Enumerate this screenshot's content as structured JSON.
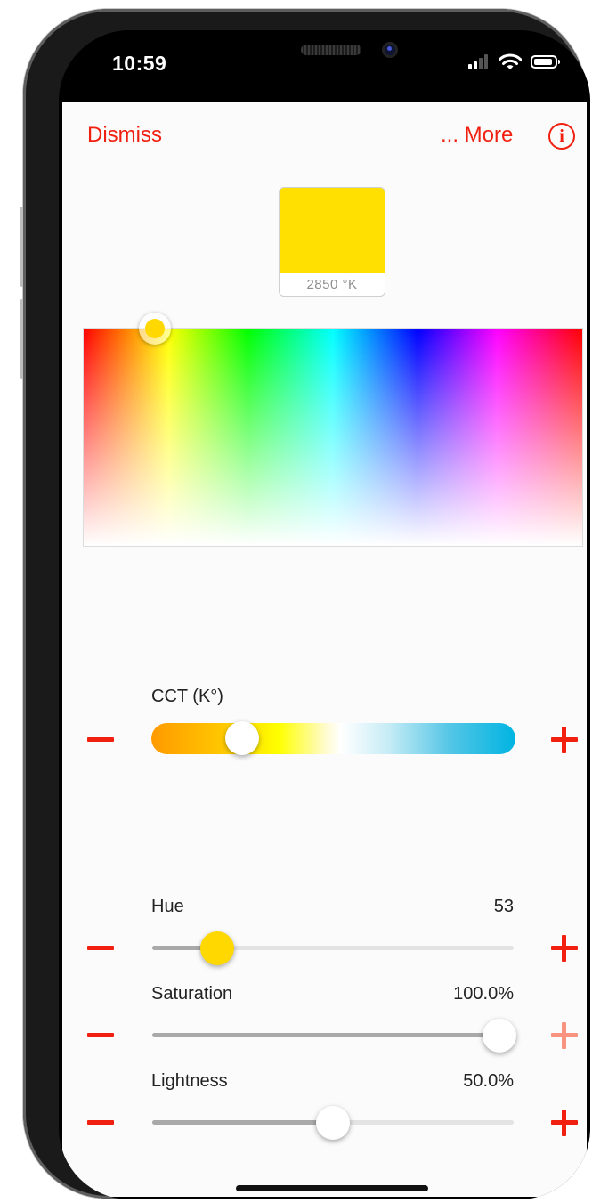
{
  "status_bar": {
    "time": "10:59"
  },
  "nav": {
    "dismiss_label": "Dismiss",
    "more_label": "... More",
    "info_icon": "info-icon"
  },
  "swatch": {
    "color": "#ffe000",
    "label": "2850 °K"
  },
  "spectrum_picker": {
    "selected_color": "#ffd800"
  },
  "cct": {
    "label": "CCT (K°)",
    "position_fraction": 0.25
  },
  "sliders": [
    {
      "label": "Hue",
      "value": "53",
      "fraction": 0.18,
      "thumb_color": "#ffd800"
    },
    {
      "label": "Saturation",
      "value": "100.0%",
      "fraction": 0.96,
      "thumb_color": "#ffffff"
    },
    {
      "label": "Lightness",
      "value": "50.0%",
      "fraction": 0.5,
      "thumb_color": "#ffffff"
    }
  ],
  "colors": {
    "accent": "#f01f0f",
    "accent_disabled": "#f7937f"
  }
}
